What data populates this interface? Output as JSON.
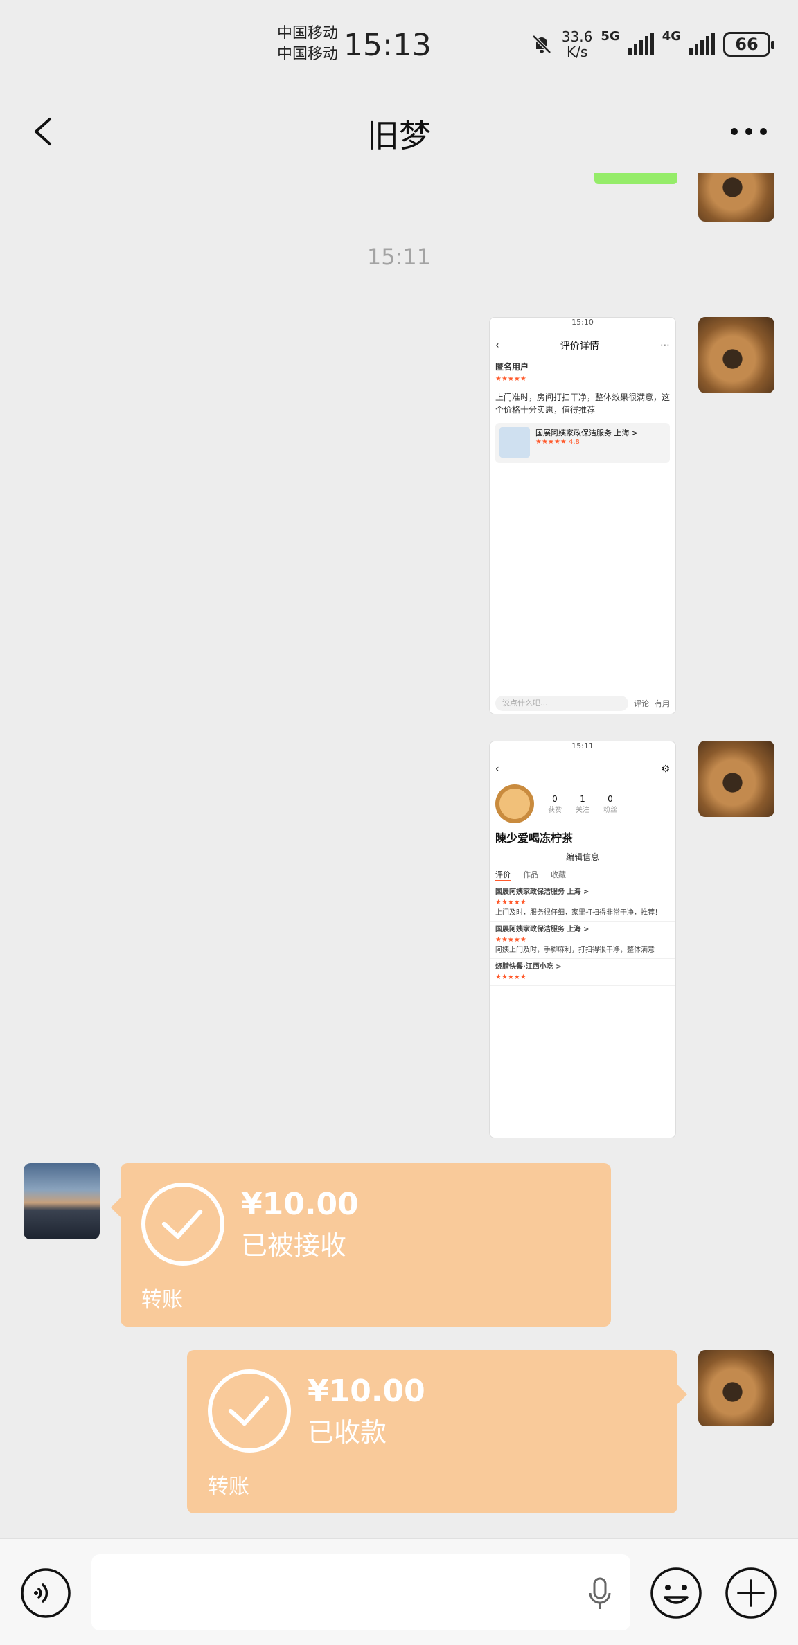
{
  "status_bar": {
    "carrier_1": "中国移动",
    "carrier_2": "中国移动",
    "time": "15:13",
    "net_speed_value": "33.6",
    "net_speed_unit": "K/s",
    "sig1_label": "5G",
    "sig2_label": "4G",
    "battery": "66"
  },
  "nav": {
    "title": "旧梦"
  },
  "chat": {
    "timestamp": "15:11",
    "screenshot1": {
      "time": "15:10",
      "title": "评价详情",
      "user": "匿名用户",
      "body": "上门准时，房间打扫干净，整体效果很满意，这个价格十分实惠，值得推荐",
      "card_title": "国展阿姨家政保洁服务 上海 >",
      "card_rating": "4.8",
      "input_placeholder": "说点什么吧...",
      "comment": "评论",
      "like": "有用"
    },
    "screenshot2": {
      "time": "15:11",
      "stat1_value": "0",
      "stat1_label": "获赞",
      "stat2_value": "1",
      "stat2_label": "关注",
      "stat3_value": "0",
      "stat3_label": "粉丝",
      "name": "陳少爱喝冻柠茶",
      "edit": "编辑信息",
      "tab1": "评价",
      "tab2": "作品",
      "tab3": "收藏",
      "review1_shop": "国展阿姨家政保洁服务 上海 >",
      "review1_text": "上门及时，服务很仔细，家里打扫得非常干净，推荐！",
      "review2_shop": "国展阿姨家政保洁服务 上海 >",
      "review2_text": "阿姨上门及时，手脚麻利，打扫得很干净，整体满意",
      "review3_shop": "烧腊快餐·江西小吃 >"
    },
    "transfer_received": {
      "amount": "¥10.00",
      "status": "已被接收",
      "label": "转账"
    },
    "transfer_collected": {
      "amount": "¥10.00",
      "status": "已收款",
      "label": "转账"
    }
  },
  "colors": {
    "accent_green": "#95ec69",
    "transfer_bg": "#f9ca9a",
    "background": "#ededed"
  }
}
